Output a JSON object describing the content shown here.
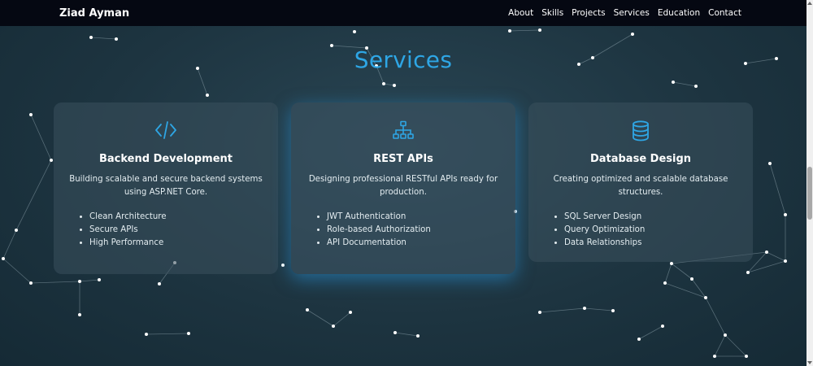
{
  "nav": {
    "brand": "Ziad Ayman",
    "links": [
      "About",
      "Skills",
      "Projects",
      "Services",
      "Education",
      "Contact"
    ]
  },
  "services": {
    "title": "Services",
    "cards": [
      {
        "icon": "code-icon",
        "title": "Backend Development",
        "description": "Building scalable and secure backend systems using ASP.NET Core.",
        "features": [
          "Clean Architecture",
          "Secure APIs",
          "High Performance"
        ]
      },
      {
        "icon": "sitemap-icon",
        "title": "REST APIs",
        "description": "Designing professional RESTful APIs ready for production.",
        "features": [
          "JWT Authentication",
          "Role-based Authorization",
          "API Documentation"
        ]
      },
      {
        "icon": "database-icon",
        "title": "Database Design",
        "description": "Creating optimized and scalable database structures.",
        "features": [
          "SQL Server Design",
          "Query Optimization",
          "Data Relationships"
        ]
      }
    ]
  },
  "colors": {
    "accent": "#2ea6e5",
    "navbar_bg": "#050812",
    "page_bg": "#1d3440"
  }
}
